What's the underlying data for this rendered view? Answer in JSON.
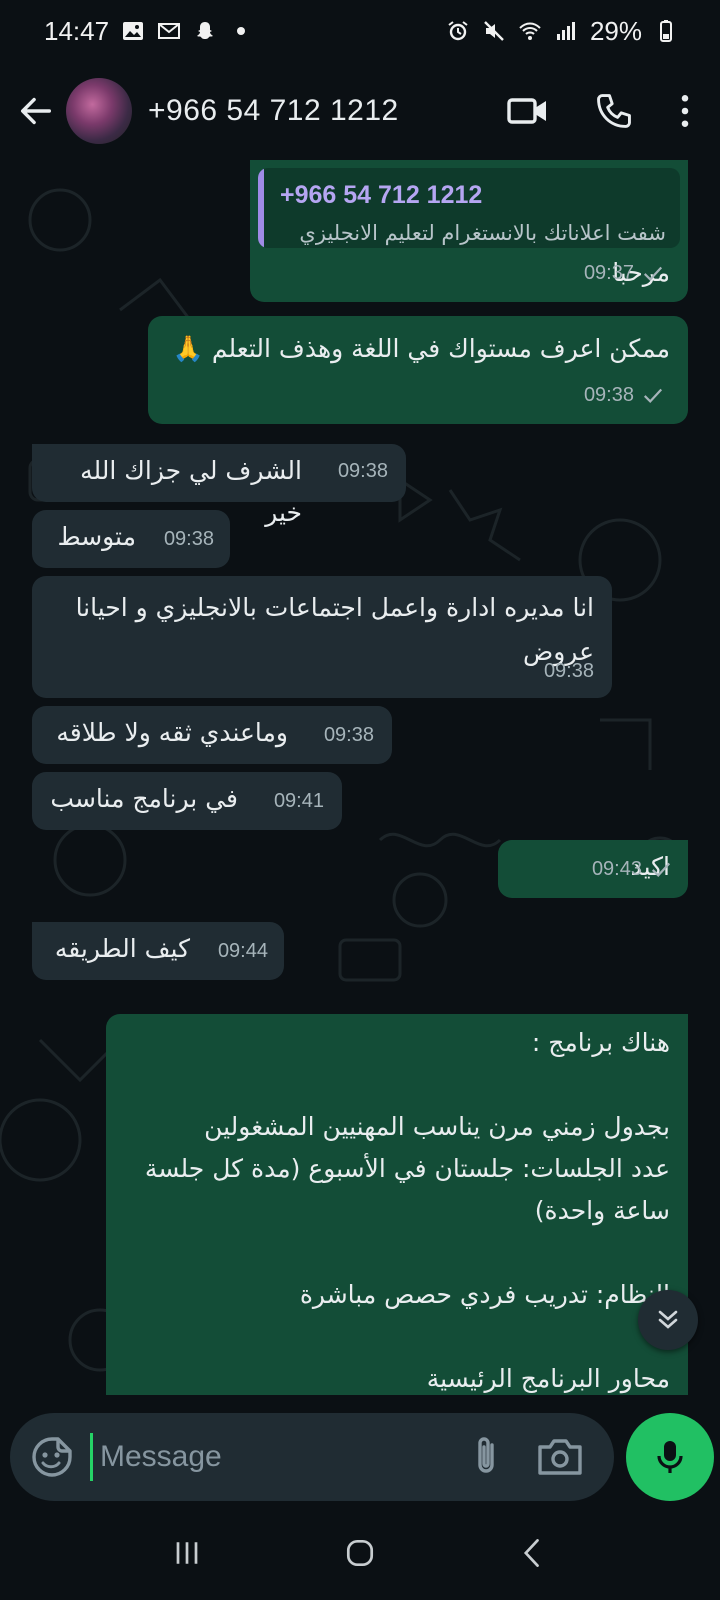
{
  "status_bar": {
    "time": "14:47",
    "battery": "29%",
    "left_icons": [
      "image-icon",
      "gmail-icon",
      "snapchat-icon",
      "dot-icon"
    ],
    "right_icons": [
      "alarm-icon",
      "mute-icon",
      "wifi-icon",
      "signal-icon",
      "battery-icon"
    ]
  },
  "header": {
    "contact_name": "+966 54 712 1212",
    "actions": [
      "video-call-icon",
      "phone-call-icon",
      "more-options-icon"
    ]
  },
  "messages": [
    {
      "direction": "out",
      "quote": {
        "name": "+966 54 712 1212",
        "text": "شفت اعلاناتك بالانستغرام لتعليم الانجليزي"
      },
      "text": "مرحبا",
      "time": "09:37",
      "status": "sent"
    },
    {
      "direction": "out",
      "text": "ممكن اعرف مستواك في اللغة وهذف التعلم 🙏",
      "time": "09:38",
      "status": "sent"
    },
    {
      "direction": "in",
      "text": "الشرف لي جزاك الله خير",
      "time": "09:38"
    },
    {
      "direction": "in",
      "text": "متوسط",
      "time": "09:38"
    },
    {
      "direction": "in",
      "text": "انا مديره ادارة واعمل اجتماعات بالانجليزي و احيانا عروض",
      "time": "09:38"
    },
    {
      "direction": "in",
      "text": "وماعندي ثقه ولا طلاقه",
      "time": "09:38"
    },
    {
      "direction": "in",
      "text": "في برنامج مناسب",
      "time": "09:41"
    },
    {
      "direction": "out",
      "text": "اكيد",
      "time": "09:43",
      "status": "sent"
    },
    {
      "direction": "in",
      "text": "كيف الطريقه",
      "time": "09:44"
    },
    {
      "direction": "out",
      "lines": [
        "هناك برنامج :",
        "",
        " بجدول زمني مرن يناسب المهنيين المشغولين",
        "عدد الجلسات: جلستان في الأسبوع (مدة كل جلسة",
        "ساعة واحدة)",
        "",
        "النظام: تدريب فردي حصص مباشرة",
        "",
        "محاور البرنامج الرئيسية"
      ]
    }
  ],
  "composer": {
    "placeholder": "Message",
    "icons": [
      "emoji-icon",
      "attachment-icon",
      "camera-icon",
      "microphone-icon"
    ]
  },
  "nav_bar": [
    "recent-apps-icon",
    "home-icon",
    "back-nav-icon"
  ],
  "colors": {
    "background": "#0b1014",
    "outgoing_bubble": "#134d37",
    "incoming_bubble": "#202c33",
    "accent_green": "#21c063",
    "quote_name": "#b5a6f2"
  }
}
